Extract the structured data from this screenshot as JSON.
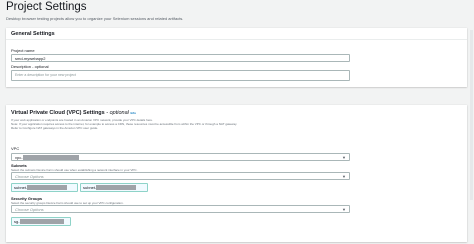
{
  "header": {
    "title": "Project Settings",
    "subtitle": "Desktop browser testing projects allow you to organize your Selenium sessions and related artifacts."
  },
  "general": {
    "heading": "General Settings",
    "name_label": "Project name",
    "name_value": "smd-mywebapp2",
    "description_label": "Description - optional",
    "description_placeholder": "Enter a description for your new project"
  },
  "vpc": {
    "heading": "Virtual Private Cloud (VPC) Settings",
    "heading_optional": "- optional",
    "info": "Info",
    "desc1": "If your web application or endpoints are hosted in an Amazon VPC network, provide your VPC details here.",
    "desc2": "Note: If your application requires access to the internet, for example to access a CDN, these resources must be accessible from within the VPC or through a NAT gateway.",
    "desc3": "Refer to Configure NAT gateways in the Amazon VPC user guide.",
    "vpc_label": "VPC",
    "vpc_prefix": "vpc-",
    "subnets_label": "Subnets",
    "subnets_desc": "Select the subnets Device Farm should use when establishing a network interface in your VPC.",
    "choose_options": "Choose Options",
    "subnet_prefix": "subnet-",
    "sg_label": "Security Groups",
    "sg_desc": "Select the security groups Device Farm should use to set up your VPC configuration.",
    "sg_prefix": "sg-"
  },
  "icons": {
    "dropdown": "caret-down-icon",
    "remove": "close-icon"
  }
}
